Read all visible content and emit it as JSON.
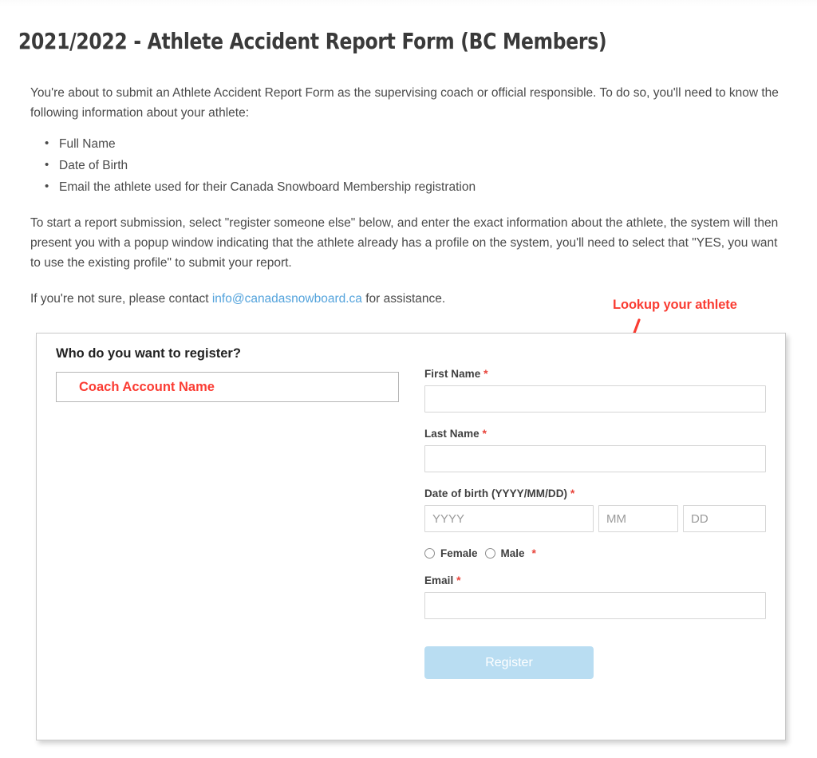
{
  "page": {
    "title": "2021/2022 - Athlete Accident Report Form (BC Members)"
  },
  "intro": {
    "paragraph1": "You're about to submit an Athlete Accident Report Form as the supervising coach or official responsible. To do so, you'll need to know the following information about your athlete:",
    "bullets": [
      "Full Name",
      "Date of Birth",
      "Email the athlete used for their Canada Snowboard Membership registration"
    ],
    "paragraph2": "To start a report submission, select \"register someone else\" below, and enter the exact information about the athlete, the system will then present you with a popup window indicating that the athlete already has a profile on the system, you'll need to select that \"YES, you want to use the existing profile\" to submit your report.",
    "contact_prefix": "If you're not sure, please contact ",
    "contact_email": "info@canadasnowboard.ca",
    "contact_suffix": " for assistance."
  },
  "annotation": {
    "label": "Lookup your athlete",
    "color": "#fa3c32"
  },
  "form": {
    "register_question": "Who do you want to register?",
    "account_name": "Coach Account Name",
    "account_name_color": "#fb3c33",
    "fields": {
      "first_name": {
        "label": "First Name",
        "required_mark": "*",
        "value": "",
        "placeholder": ""
      },
      "last_name": {
        "label": "Last Name",
        "required_mark": "*",
        "value": "",
        "placeholder": ""
      },
      "dob": {
        "label": "Date of birth (YYYY/MM/DD)",
        "required_mark": "*",
        "year_placeholder": "YYYY",
        "month_placeholder": "MM",
        "day_placeholder": "DD",
        "year_value": "",
        "month_value": "",
        "day_value": ""
      },
      "gender": {
        "option_female": "Female",
        "option_male": "Male",
        "required_mark": "*",
        "selected": ""
      },
      "email": {
        "label": "Email",
        "required_mark": "*",
        "value": "",
        "placeholder": ""
      }
    },
    "submit_label": "Register",
    "submit_color": "#b9ddf2"
  }
}
